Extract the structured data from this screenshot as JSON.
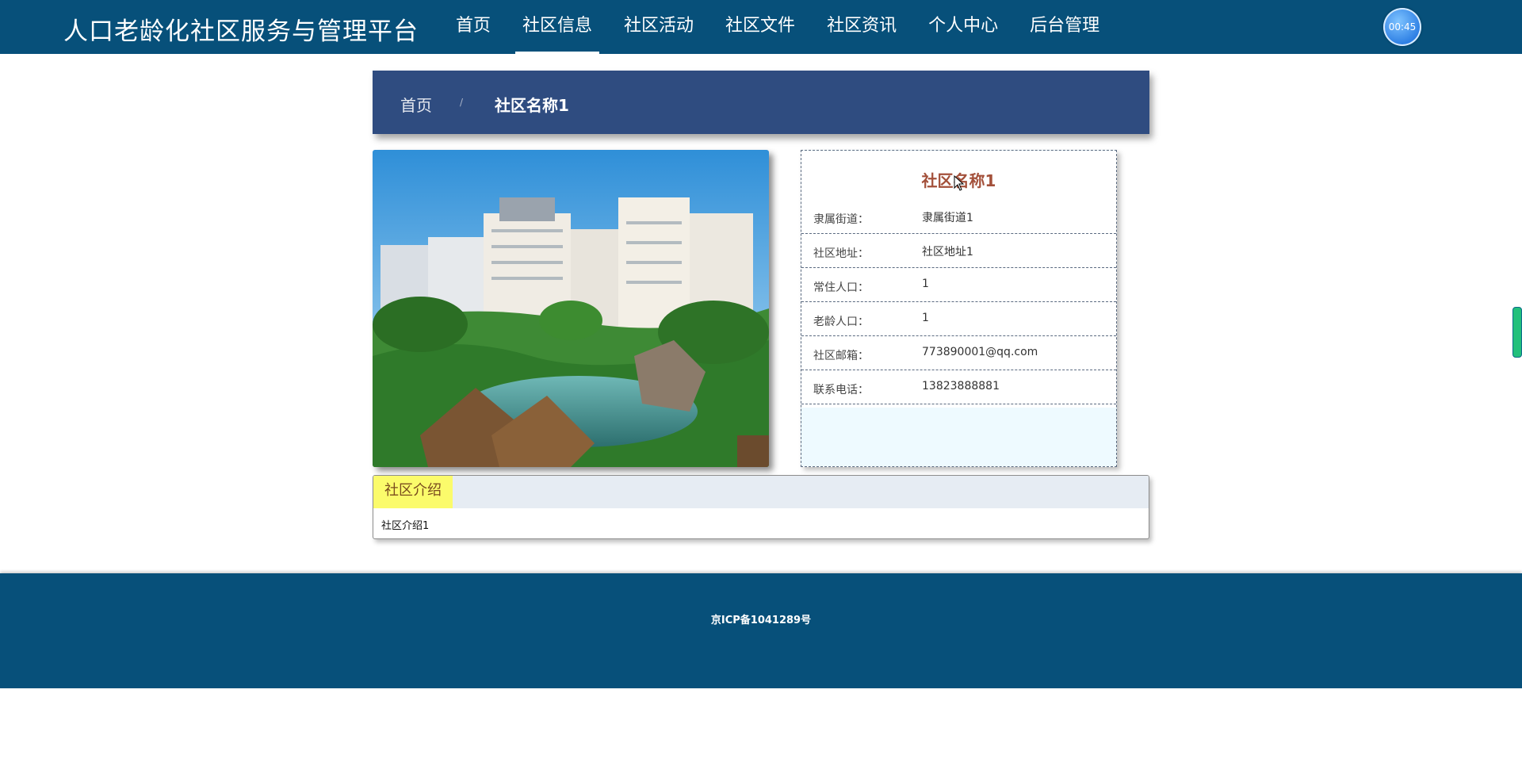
{
  "header": {
    "site_title": "人口老龄化社区服务与管理平台",
    "nav": [
      "首页",
      "社区信息",
      "社区活动",
      "社区文件",
      "社区资讯",
      "个人中心",
      "后台管理"
    ],
    "active_nav": "社区信息",
    "timer": "00:45"
  },
  "breadcrumb": {
    "home": "首页",
    "separator": "/",
    "current": "社区名称1"
  },
  "community": {
    "name": "社区名称1",
    "image_icon": "community-garden-photo",
    "fields": [
      {
        "label": "隶属街道：",
        "value": "隶属街道1"
      },
      {
        "label": "社区地址：",
        "value": "社区地址1"
      },
      {
        "label": "常住人口：",
        "value": "1"
      },
      {
        "label": "老龄人口：",
        "value": "1"
      },
      {
        "label": "社区邮箱：",
        "value": "773890001@qq.com"
      },
      {
        "label": "联系电话：",
        "value": "13823888881"
      }
    ]
  },
  "intro": {
    "tab_label": "社区介绍",
    "content": "社区介绍1"
  },
  "footer": {
    "icp": "京ICP备1041289号"
  },
  "colors": {
    "header_bg": "#07507a",
    "breadcrumb_bg": "#2f4c80",
    "title_accent": "#a3503a",
    "tab_highlight": "#fbfb6b"
  }
}
